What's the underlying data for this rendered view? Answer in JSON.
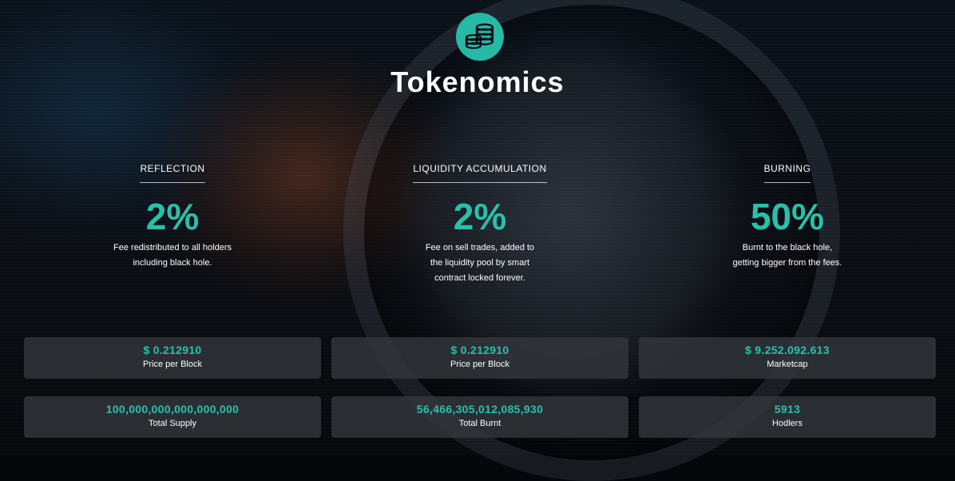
{
  "section": {
    "title": "Tokenomics",
    "icon": "coin-stack-icon",
    "accent_color": "#29c0ab"
  },
  "fees": [
    {
      "heading": "REFLECTION",
      "percent": "2%",
      "desc_line1": "Fee redistributed to all holders",
      "desc_line2": "including black hole."
    },
    {
      "heading": "LIQUIDITY ACCUMULATION",
      "percent": "2%",
      "desc_line1": "Fee on sell trades, added to",
      "desc_line2": "the liquidity pool by smart",
      "desc_line3": "contract locked forever."
    },
    {
      "heading": "BURNING",
      "percent": "50%",
      "desc_line1": "Burnt to the black hole,",
      "desc_line2": "getting bigger from the fees."
    }
  ],
  "stats": [
    {
      "value": "$ 0.212910",
      "label": "Price per Block"
    },
    {
      "value": "$ 0.212910",
      "label": "Price per Block"
    },
    {
      "value": "$ 9.252.092.613",
      "label": "Marketcap"
    },
    {
      "value": "100,000,000,000,000,000",
      "label": "Total Supply"
    },
    {
      "value": "56,466,305,012,085,930",
      "label": "Total Burnt"
    },
    {
      "value": "5913",
      "label": "Hodlers"
    }
  ]
}
